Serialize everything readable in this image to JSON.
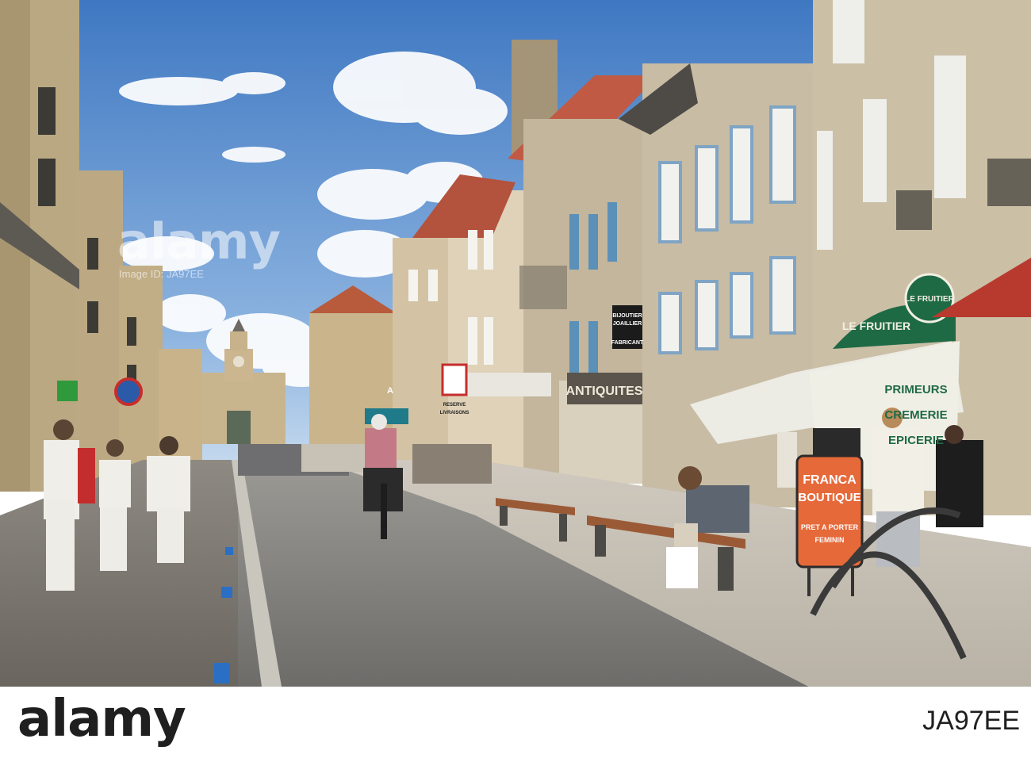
{
  "scene": {
    "description_tag": "photo"
  },
  "signs": {
    "le_fruitier_top": "LE FRUITIER",
    "le_fruitier_main": "LE FRUITIER",
    "primeurs": "PRIMEURS",
    "cremerie": "CREMERIE",
    "epicerie": "EPICERIE",
    "antiquites": "ANTIQUITES",
    "bijoutier_1": "BIJOUTIER",
    "bijoutier_2": "JOAILLIER",
    "bijoutier_3": "FABRICANT",
    "franca_1": "FRANCA",
    "franca_2": "BOUTIQUE",
    "franca_3": "PRET A PORTER",
    "franca_4": "FEMININ",
    "reserve": "RESERVE",
    "livraisons": "LIVRAISONS",
    "a_sign": "A"
  },
  "watermark": {
    "main": "alamy",
    "sub": "Image ID: JA97EE"
  },
  "footer": {
    "brand": "alamy",
    "stock_id": "JA97EE"
  },
  "colors": {
    "sky": "#4f87c9",
    "awning_green": "#1e6a45",
    "awning_red": "#b83a2e",
    "franca_orange": "#e6693a"
  }
}
